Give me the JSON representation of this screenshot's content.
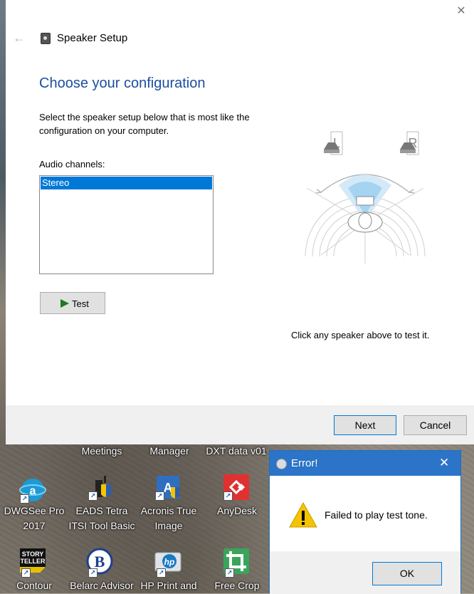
{
  "window": {
    "title": "Speaker Setup",
    "heading": "Choose your configuration",
    "description": "Select the speaker setup below that is most like the configuration on your computer.",
    "channels_label": "Audio channels:",
    "channels": [
      "Stereo"
    ],
    "selected_channel": "Stereo",
    "test_label": "Test",
    "hint": "Click any speaker above to test it.",
    "next_label": "Next",
    "cancel_label": "Cancel",
    "speakers": {
      "left": "L",
      "right": "R"
    }
  },
  "desktop": {
    "top_labels": [
      "Meetings",
      "Manager",
      "DXT data v01"
    ],
    "icons": [
      {
        "line1": "DWGSee Pro",
        "line2": "2017",
        "icon": "dwgsee-icon"
      },
      {
        "line1": "EADS Tetra",
        "line2": "ITSI Tool Basic",
        "icon": "eads-tetra-icon"
      },
      {
        "line1": "Acronis True",
        "line2": "Image",
        "icon": "acronis-icon"
      },
      {
        "line1": "AnyDesk",
        "line2": "",
        "icon": "anydesk-icon"
      },
      {
        "line1": "Contour",
        "icon": "storyteller-icon"
      },
      {
        "line1": "Belarc Advisor",
        "icon": "belarc-icon"
      },
      {
        "line1": "HP Print and",
        "icon": "hp-print-icon"
      },
      {
        "line1": "Free Crop",
        "icon": "free-crop-icon"
      }
    ]
  },
  "error_dialog": {
    "title": "Error!",
    "message": "Failed to play test tone.",
    "ok_label": "OK"
  },
  "colors": {
    "accent": "#0078d7",
    "heading": "#1b4fa0",
    "error_titlebar": "#2b74c7",
    "warning": "#f5c400"
  }
}
